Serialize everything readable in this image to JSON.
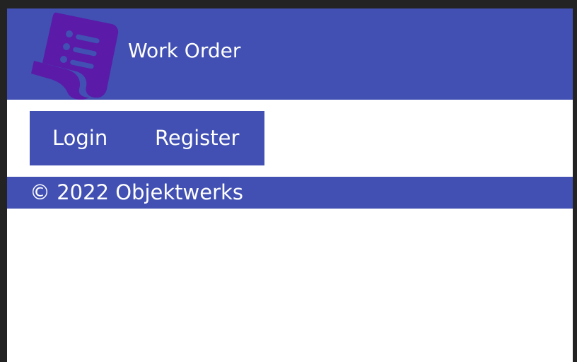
{
  "header": {
    "logo_icon": "document-list-icon",
    "title": "Work Order"
  },
  "nav": {
    "items": [
      {
        "label": "Login"
      },
      {
        "label": "Register"
      }
    ]
  },
  "footer": {
    "copyright": "© 2022 Objektwerks"
  },
  "colors": {
    "primary": "#4150b2",
    "logo": "#5b1aa8",
    "background": "#ffffff",
    "frame": "#232323"
  }
}
